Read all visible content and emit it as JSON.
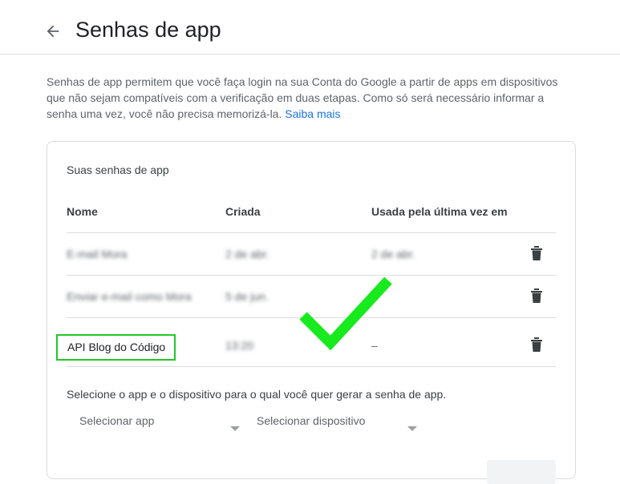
{
  "header": {
    "title": "Senhas de app",
    "back_icon": "arrow-back-icon"
  },
  "intro": {
    "text": "Senhas de app permitem que você faça login na sua Conta do Google a partir de apps em dispositivos que não sejam compatíveis com a verificação em duas etapas. Como só será necessário informar a senha uma vez, você não precisa memorizá-la.",
    "link": "Saiba mais",
    "link_color": "#1a73e8"
  },
  "card": {
    "title": "Suas senhas de app",
    "columns": [
      "Nome",
      "Criada",
      "Usada pela última vez em"
    ],
    "rows": [
      {
        "name": "E-mail Mora",
        "created": "2 de abr.",
        "last_used": "2 de abr.",
        "blurred": true
      },
      {
        "name": "Enviar e-mail como Mora",
        "created": "5 de jun.",
        "last_used": "",
        "blurred": true
      },
      {
        "name": "API Blog do Código",
        "created": "13:20",
        "last_used": "–",
        "blurred": false
      }
    ],
    "delete_icon": "trash-icon",
    "select_prompt": "Selecione o app e o dispositivo para o qual você quer gerar a senha de app.",
    "select_app": "Selecionar app",
    "select_device": "Selecionar dispositivo"
  },
  "colors": {
    "highlight": "#22c52a",
    "checkmark": "#17ea1d"
  }
}
